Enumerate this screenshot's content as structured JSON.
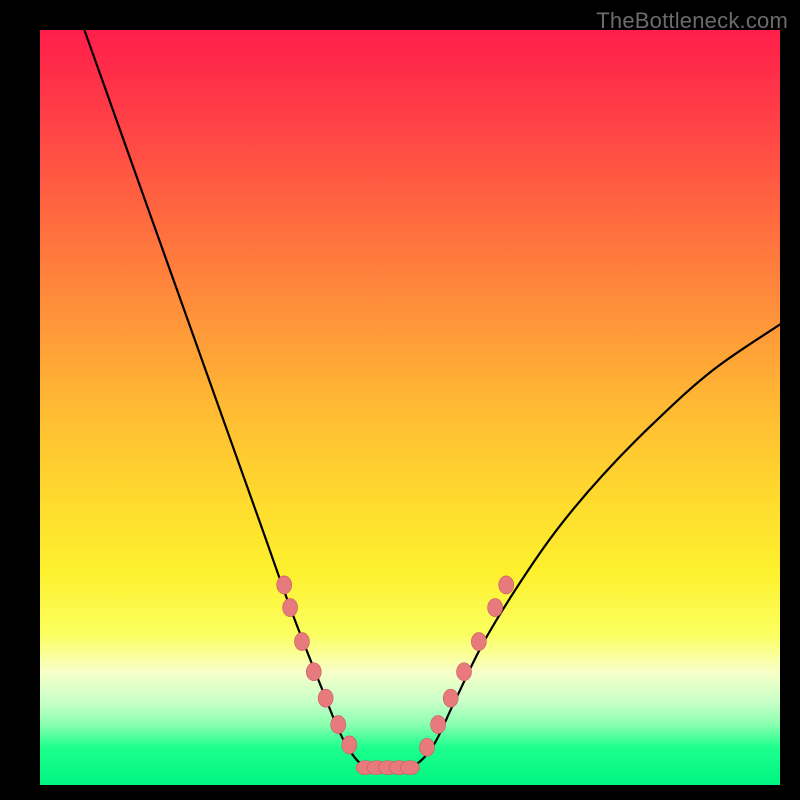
{
  "watermark": {
    "text": "TheBottleneck.com"
  },
  "colors": {
    "curve_stroke": "#000000",
    "marker_fill": "#e77a7d",
    "marker_stroke": "#cc5a5e"
  },
  "chart_data": {
    "type": "line",
    "title": "",
    "xlabel": "",
    "ylabel": "",
    "xlim": [
      0,
      100
    ],
    "ylim": [
      0,
      100
    ],
    "curve": [
      {
        "x": 6,
        "y": 100
      },
      {
        "x": 10,
        "y": 89
      },
      {
        "x": 14,
        "y": 78
      },
      {
        "x": 18,
        "y": 67
      },
      {
        "x": 22,
        "y": 56
      },
      {
        "x": 26,
        "y": 45
      },
      {
        "x": 30,
        "y": 34
      },
      {
        "x": 34,
        "y": 23
      },
      {
        "x": 38,
        "y": 13
      },
      {
        "x": 41,
        "y": 6
      },
      {
        "x": 44,
        "y": 2.3
      },
      {
        "x": 47,
        "y": 2.3
      },
      {
        "x": 50,
        "y": 2.3
      },
      {
        "x": 53,
        "y": 5
      },
      {
        "x": 56,
        "y": 11
      },
      {
        "x": 60,
        "y": 19
      },
      {
        "x": 65,
        "y": 27
      },
      {
        "x": 70,
        "y": 34
      },
      {
        "x": 76,
        "y": 41
      },
      {
        "x": 83,
        "y": 48
      },
      {
        "x": 91,
        "y": 55
      },
      {
        "x": 100,
        "y": 61
      }
    ],
    "markers_left": [
      {
        "x": 33.0,
        "y": 26.5
      },
      {
        "x": 33.8,
        "y": 23.5
      },
      {
        "x": 35.4,
        "y": 19.0
      },
      {
        "x": 37.0,
        "y": 15.0
      },
      {
        "x": 38.6,
        "y": 11.5
      },
      {
        "x": 40.3,
        "y": 8.0
      },
      {
        "x": 41.8,
        "y": 5.3
      }
    ],
    "markers_bottom": [
      {
        "x": 44.0,
        "y": 2.3
      },
      {
        "x": 45.5,
        "y": 2.3
      },
      {
        "x": 47.0,
        "y": 2.3
      },
      {
        "x": 48.5,
        "y": 2.3
      },
      {
        "x": 50.0,
        "y": 2.3
      }
    ],
    "markers_right": [
      {
        "x": 52.3,
        "y": 5.0
      },
      {
        "x": 53.8,
        "y": 8.0
      },
      {
        "x": 55.5,
        "y": 11.5
      },
      {
        "x": 57.3,
        "y": 15.0
      },
      {
        "x": 59.3,
        "y": 19.0
      },
      {
        "x": 61.5,
        "y": 23.5
      },
      {
        "x": 63.0,
        "y": 26.5
      }
    ]
  }
}
